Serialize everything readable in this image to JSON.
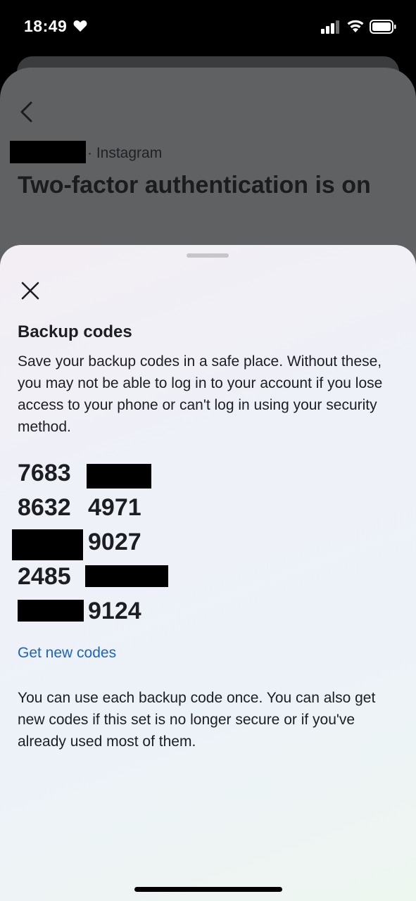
{
  "status_bar": {
    "time": "18:49",
    "icons": [
      "heart-icon",
      "signal-icon",
      "wifi-icon",
      "battery-icon"
    ]
  },
  "background_page": {
    "account_suffix": "· Instagram",
    "title": "Two-factor authentication is on"
  },
  "sheet": {
    "heading": "Backup codes",
    "description": "Save your backup codes in a safe place. Without these, you may not be able to log in to your account if you lose access to your phone or can't log in using your security method.",
    "codes": [
      {
        "first": "7683",
        "second": ""
      },
      {
        "first": "8632",
        "second": "4971"
      },
      {
        "first": "",
        "second": "9027"
      },
      {
        "first": "2485",
        "second": ""
      },
      {
        "first": "",
        "second": "9124"
      }
    ],
    "get_new_codes_label": "Get new codes",
    "footer": "You can use each backup code once. You can also get new codes if this set is no longer secure or if you've already used most of them."
  },
  "colors": {
    "link": "#1a64c4",
    "text": "#1c1e21",
    "overlay": "#5f6163"
  }
}
